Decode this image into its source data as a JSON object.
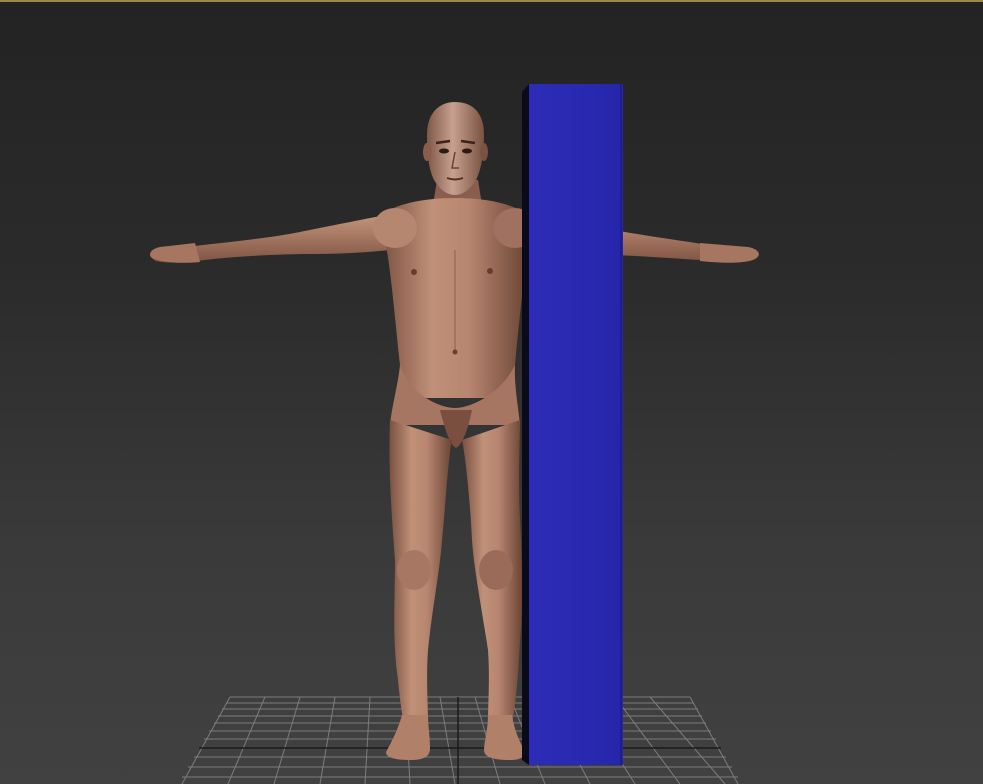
{
  "viewport": {
    "active_border_color": "#9a8a50",
    "background_top": "#232323",
    "background_bottom": "#414141"
  },
  "scene": {
    "objects": [
      {
        "name": "human-figure",
        "skin_color": "#b0806a"
      },
      {
        "name": "box-object",
        "color": "#2a2ab4"
      },
      {
        "name": "ground-grid",
        "color": "#8a8a8a"
      }
    ]
  }
}
